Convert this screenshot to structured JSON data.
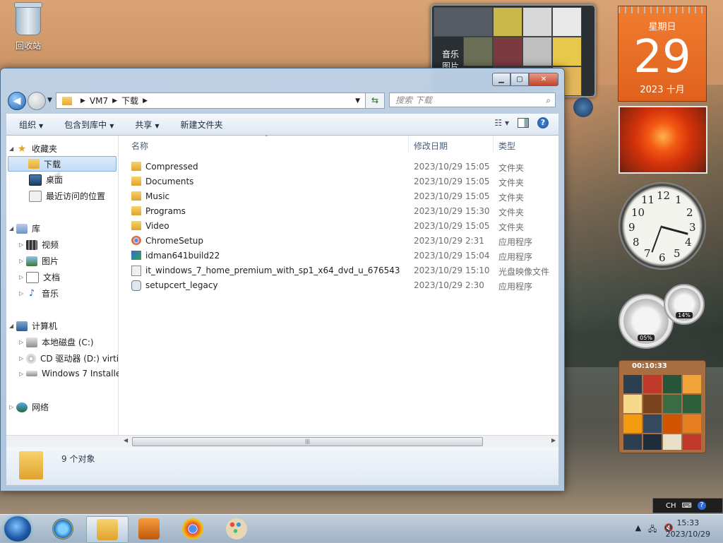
{
  "desktop": {
    "recycle_bin_label": "回收站",
    "media_gadget_label": "音乐",
    "media_gadget_label2": "图片",
    "calendar": {
      "weekday": "星期日",
      "day": "29",
      "year_month": "2023 十月"
    },
    "cpu_meter": {
      "percent": "05%"
    },
    "mem_meter": {
      "percent": "14%"
    },
    "puzzle_timer": "00:10:33",
    "clock_numbers": [
      "12",
      "1",
      "2",
      "3",
      "4",
      "5",
      "6",
      "7",
      "8",
      "9",
      "10",
      "11"
    ]
  },
  "window": {
    "address": {
      "segments": [
        "VM7",
        "下载"
      ]
    },
    "search_placeholder": "搜索 下载",
    "toolbar": {
      "organize": "组织",
      "include_library": "包含到库中",
      "share": "共享",
      "new_folder": "新建文件夹"
    },
    "nav": {
      "favorites": "收藏夹",
      "downloads": "下载",
      "desktop": "桌面",
      "recent": "最近访问的位置",
      "libraries": "库",
      "videos": "视频",
      "pictures": "图片",
      "documents": "文档",
      "music": "音乐",
      "computer": "计算机",
      "local_disk": "本地磁盘 (C:)",
      "cd_drive": "CD 驱动器 (D:) virti",
      "win7_install": "Windows 7 Installe",
      "network": "网络"
    },
    "columns": {
      "name": "名称",
      "date": "修改日期",
      "type": "类型"
    },
    "files": [
      {
        "name": "Compressed",
        "date": "2023/10/29 15:05",
        "type": "文件夹"
      },
      {
        "name": "Documents",
        "date": "2023/10/29 15:05",
        "type": "文件夹"
      },
      {
        "name": "Music",
        "date": "2023/10/29 15:05",
        "type": "文件夹"
      },
      {
        "name": "Programs",
        "date": "2023/10/29 15:30",
        "type": "文件夹"
      },
      {
        "name": "Video",
        "date": "2023/10/29 15:05",
        "type": "文件夹"
      },
      {
        "name": "ChromeSetup",
        "date": "2023/10/29 2:31",
        "type": "应用程序"
      },
      {
        "name": "idman641build22",
        "date": "2023/10/29 15:04",
        "type": "应用程序"
      },
      {
        "name": "it_windows_7_home_premium_with_sp1_x64_dvd_u_676543",
        "date": "2023/10/29 15:10",
        "type": "光盘映像文件"
      },
      {
        "name": "setupcert_legacy",
        "date": "2023/10/29 2:30",
        "type": "应用程序"
      }
    ],
    "status": {
      "count": "9 个对象"
    }
  },
  "taskbar": {
    "time": "15:33",
    "date": "2023/10/29",
    "lang": "CH"
  }
}
